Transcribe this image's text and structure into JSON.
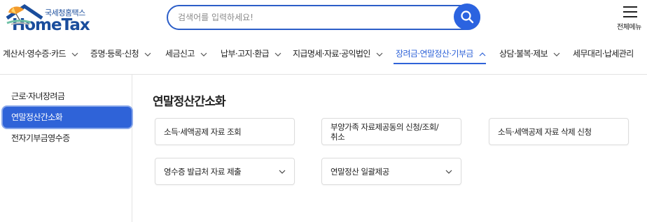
{
  "header": {
    "logo_sub": "국세청홈택스",
    "logo_main": "HomeTax",
    "search": {
      "placeholder": "검색어를 입력하세요!"
    },
    "menu_label": "전체메뉴"
  },
  "topnav": {
    "items": [
      {
        "label": "계산서·영수증·카드"
      },
      {
        "label": "증명·등록·신청"
      },
      {
        "label": "세금신고"
      },
      {
        "label": "납부·고지·환급"
      },
      {
        "label": "지급명세·자료·공익법인"
      },
      {
        "label": "장려금·연말정산·기부금",
        "active": true
      },
      {
        "label": "상담·불복·제보"
      },
      {
        "label": "세무대리·납세관리"
      }
    ]
  },
  "sidebar": {
    "items": [
      {
        "label": "근로·자녀장려금"
      },
      {
        "label": "연말정산간소화",
        "active": true
      },
      {
        "label": "전자기부금영수증"
      }
    ]
  },
  "main": {
    "title": "연말정산간소화",
    "cards": [
      {
        "label": "소득·세액공제 자료 조회"
      },
      {
        "label": "부양가족 자료제공동의 신청/조회/",
        "label2": "취소"
      },
      {
        "label": "소득·세액공제 자료 삭제 신청"
      },
      {
        "label": "영수증 발급처 자료 제출",
        "has_dropdown": true
      },
      {
        "label": "연말정산 일괄제공",
        "has_dropdown": true
      }
    ]
  },
  "colors": {
    "accent": "#2f63d8",
    "logo": "#1a4d9c"
  }
}
